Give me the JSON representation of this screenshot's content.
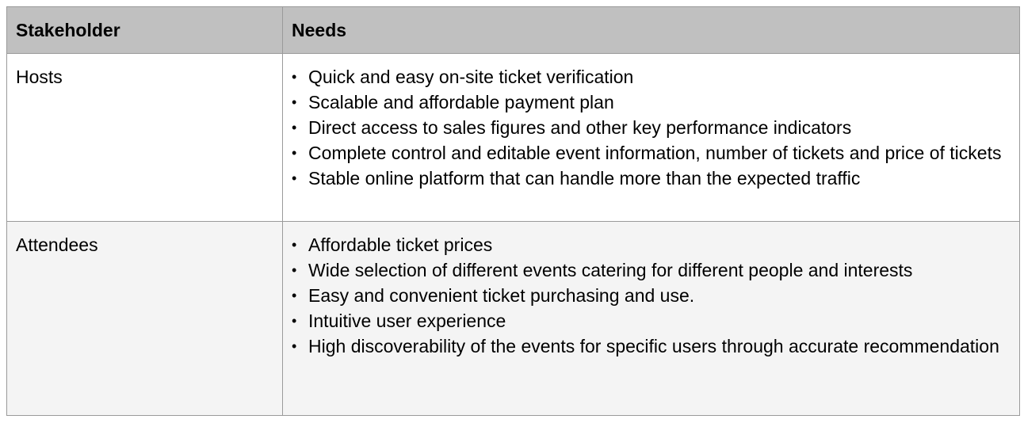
{
  "table": {
    "headers": {
      "stakeholder": "Stakeholder",
      "needs": "Needs"
    },
    "bullet_symbol": "•",
    "rows": [
      {
        "stakeholder": "Hosts",
        "needs": [
          "Quick and easy on-site ticket verification",
          "Scalable and affordable payment plan",
          "Direct access to sales figures and other key performance indicators",
          "Complete control and editable event information, number of tickets and price of tickets",
          "Stable online platform that can handle more than the expected traffic"
        ]
      },
      {
        "stakeholder": "Attendees",
        "needs": [
          "Affordable ticket prices",
          "Wide selection of different events catering for different people and interests",
          "Easy and convenient ticket purchasing and use.",
          "Intuitive user experience",
          "High discoverability of the events for specific users through accurate recommendation"
        ]
      }
    ]
  },
  "colors": {
    "header_background": "#c0c0c0",
    "row_alt_background": "#f4f4f4",
    "border": "#9a9a9a"
  }
}
